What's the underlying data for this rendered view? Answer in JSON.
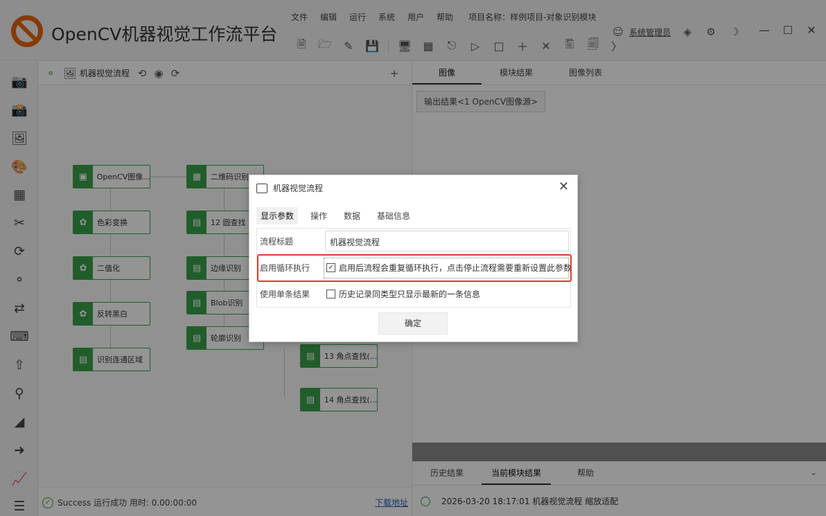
{
  "app": {
    "title": "OpenCV机器视觉工作流平台",
    "menu": [
      "文件",
      "编辑",
      "运行",
      "系统",
      "用户",
      "帮助"
    ],
    "project_label": "项目名称：样例项目-对象识别模块",
    "user_name": "系统管理员"
  },
  "flow": {
    "title": "机器视觉流程",
    "add_symbol": "+",
    "nodes": [
      {
        "label": "OpenCV图像..."
      },
      {
        "label": "色彩变换"
      },
      {
        "label": "二值化"
      },
      {
        "label": "反转黑白"
      },
      {
        "label": "识别连通区域"
      },
      {
        "label": "二维码识别"
      },
      {
        "label": "12 圆查找"
      },
      {
        "label": "边缘识别"
      },
      {
        "label": "Blob识别"
      },
      {
        "label": "轮廓识别"
      },
      {
        "label": "13 角点查找(..."
      },
      {
        "label": "14 角点查找(..."
      }
    ]
  },
  "status": {
    "text": "Success 运行成功 用时: 0.00:00:00",
    "download": "下载地址"
  },
  "right_panel": {
    "tabs": [
      "图像",
      "模块结果",
      "图像列表"
    ],
    "active_tab": "图像",
    "result_label": "输出结果<1 OpenCV图像源>",
    "bottom_tabs": [
      "历史结果",
      "当前模块结果",
      "帮助"
    ],
    "active_bottom_tab": "当前模块结果",
    "log_entry": "2026-03-20 18:17:01  机器视觉流程 缩放适配"
  },
  "dialog": {
    "title": "机器视觉流程",
    "tabs": [
      "显示参数",
      "操作",
      "数据",
      "基础信息"
    ],
    "active_tab": "显示参数",
    "rows": {
      "flow_title": {
        "label": "流程标题",
        "value": "机器视觉流程"
      },
      "loop": {
        "label": "启用循环执行",
        "checkbox_text": "启用后流程会重复循环执行，点击停止流程需要重新设置此参数",
        "checked": true
      },
      "single": {
        "label": "使用单条结果",
        "checkbox_text": "历史记录同类型只显示最新的一条信息",
        "checked": false
      }
    },
    "ok_label": "确定"
  },
  "colors": {
    "node_green": "#3aa04a",
    "highlight_red": "#e03a2e",
    "logo_orange": "#e8640c"
  }
}
